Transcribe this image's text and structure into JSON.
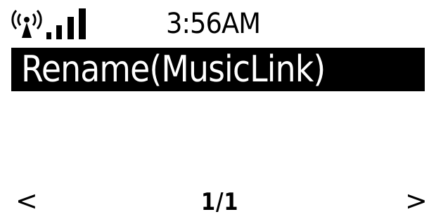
{
  "status": {
    "signal_icon": "wifi-signal-icon",
    "time": "3:56AM"
  },
  "menu": {
    "selected_item": "Rename(MusicLink)"
  },
  "navigation": {
    "prev_symbol": "<",
    "page_indicator": "1/1",
    "next_symbol": ">"
  }
}
